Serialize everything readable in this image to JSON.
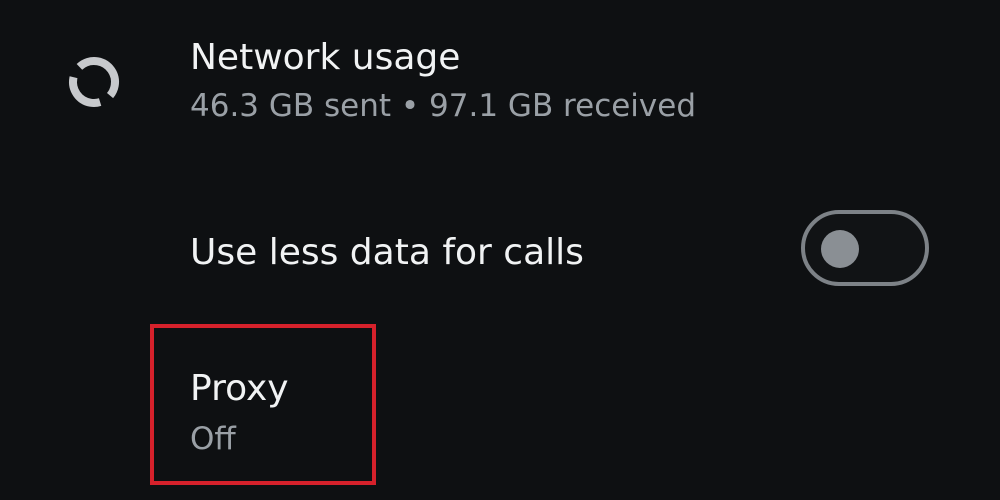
{
  "network_usage": {
    "title": "Network usage",
    "summary": "46.3 GB sent • 97.1 GB received",
    "icon": "data-usage-icon"
  },
  "calls_setting": {
    "label": "Use less data for calls",
    "enabled": false
  },
  "proxy": {
    "title": "Proxy",
    "status": "Off",
    "highlight_color": "#d6212b"
  },
  "colors": {
    "background": "#0e1012",
    "primary_text": "#f1f3f4",
    "secondary_text": "#9aa0a6",
    "toggle_outline": "#7d8287",
    "toggle_knob": "#8a8f94"
  }
}
